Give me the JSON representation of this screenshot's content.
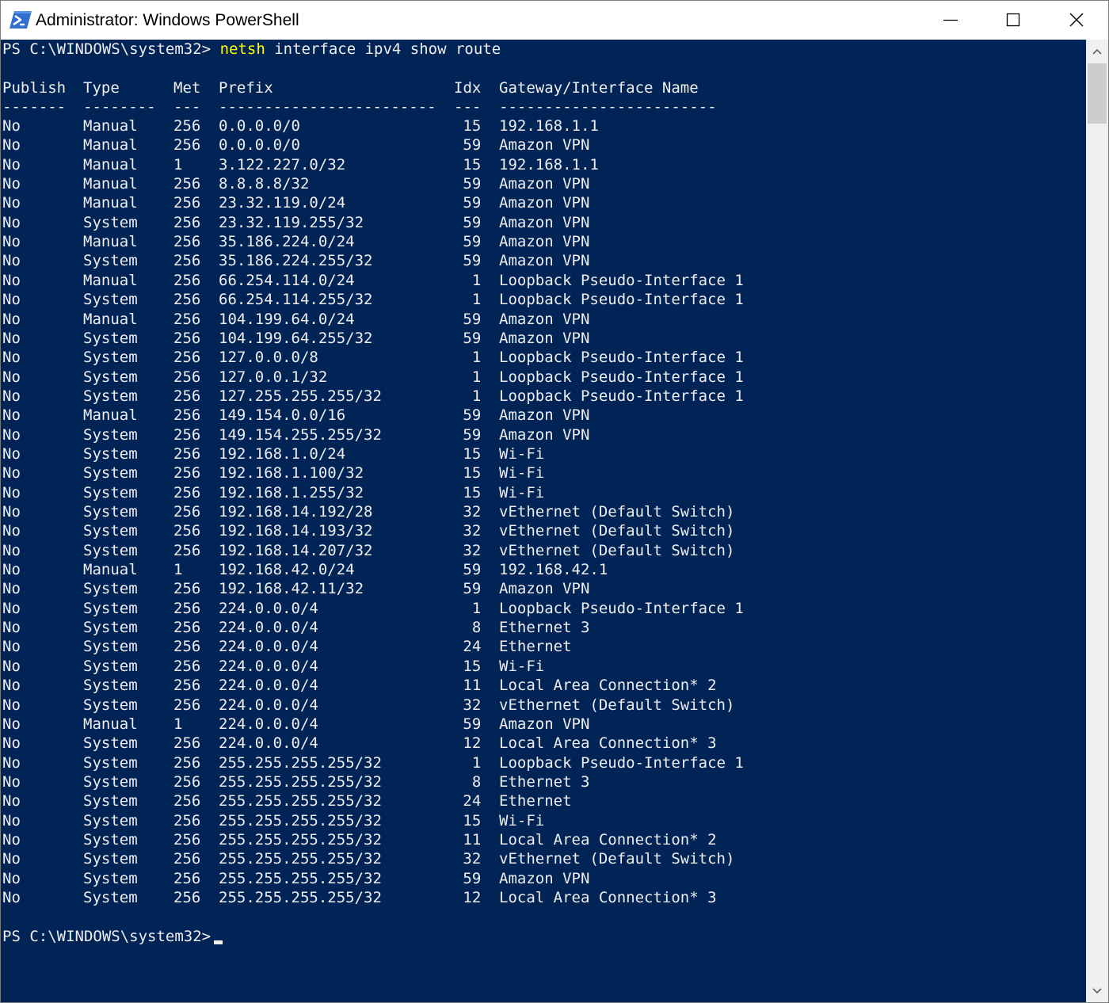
{
  "window": {
    "title": "Administrator: Windows PowerShell",
    "icon": "powershell-icon",
    "controls": {
      "minimize": "minimize-icon",
      "maximize": "maximize-icon",
      "close": "close-icon"
    }
  },
  "colors": {
    "console_bg": "#012456",
    "text": "#eeedf0",
    "command_highlight": "#ffff00"
  },
  "console": {
    "prompt": "PS C:\\WINDOWS\\system32>",
    "command": {
      "program": "netsh",
      "args": "interface ipv4 show route"
    },
    "headers": [
      "Publish",
      "Type",
      "Met",
      "Prefix",
      "Idx",
      "Gateway/Interface Name"
    ],
    "separators": [
      "-------",
      "--------",
      "---",
      "------------------------",
      "---",
      "------------------------"
    ],
    "rows": [
      [
        "No",
        "Manual",
        "256",
        "0.0.0.0/0",
        "15",
        "192.168.1.1"
      ],
      [
        "No",
        "Manual",
        "256",
        "0.0.0.0/0",
        "59",
        "Amazon VPN"
      ],
      [
        "No",
        "Manual",
        "1",
        "3.122.227.0/32",
        "15",
        "192.168.1.1"
      ],
      [
        "No",
        "Manual",
        "256",
        "8.8.8.8/32",
        "59",
        "Amazon VPN"
      ],
      [
        "No",
        "Manual",
        "256",
        "23.32.119.0/24",
        "59",
        "Amazon VPN"
      ],
      [
        "No",
        "System",
        "256",
        "23.32.119.255/32",
        "59",
        "Amazon VPN"
      ],
      [
        "No",
        "Manual",
        "256",
        "35.186.224.0/24",
        "59",
        "Amazon VPN"
      ],
      [
        "No",
        "System",
        "256",
        "35.186.224.255/32",
        "59",
        "Amazon VPN"
      ],
      [
        "No",
        "Manual",
        "256",
        "66.254.114.0/24",
        "1",
        "Loopback Pseudo-Interface 1"
      ],
      [
        "No",
        "System",
        "256",
        "66.254.114.255/32",
        "1",
        "Loopback Pseudo-Interface 1"
      ],
      [
        "No",
        "Manual",
        "256",
        "104.199.64.0/24",
        "59",
        "Amazon VPN"
      ],
      [
        "No",
        "System",
        "256",
        "104.199.64.255/32",
        "59",
        "Amazon VPN"
      ],
      [
        "No",
        "System",
        "256",
        "127.0.0.0/8",
        "1",
        "Loopback Pseudo-Interface 1"
      ],
      [
        "No",
        "System",
        "256",
        "127.0.0.1/32",
        "1",
        "Loopback Pseudo-Interface 1"
      ],
      [
        "No",
        "System",
        "256",
        "127.255.255.255/32",
        "1",
        "Loopback Pseudo-Interface 1"
      ],
      [
        "No",
        "Manual",
        "256",
        "149.154.0.0/16",
        "59",
        "Amazon VPN"
      ],
      [
        "No",
        "System",
        "256",
        "149.154.255.255/32",
        "59",
        "Amazon VPN"
      ],
      [
        "No",
        "System",
        "256",
        "192.168.1.0/24",
        "15",
        "Wi-Fi"
      ],
      [
        "No",
        "System",
        "256",
        "192.168.1.100/32",
        "15",
        "Wi-Fi"
      ],
      [
        "No",
        "System",
        "256",
        "192.168.1.255/32",
        "15",
        "Wi-Fi"
      ],
      [
        "No",
        "System",
        "256",
        "192.168.14.192/28",
        "32",
        "vEthernet (Default Switch)"
      ],
      [
        "No",
        "System",
        "256",
        "192.168.14.193/32",
        "32",
        "vEthernet (Default Switch)"
      ],
      [
        "No",
        "System",
        "256",
        "192.168.14.207/32",
        "32",
        "vEthernet (Default Switch)"
      ],
      [
        "No",
        "Manual",
        "1",
        "192.168.42.0/24",
        "59",
        "192.168.42.1"
      ],
      [
        "No",
        "System",
        "256",
        "192.168.42.11/32",
        "59",
        "Amazon VPN"
      ],
      [
        "No",
        "System",
        "256",
        "224.0.0.0/4",
        "1",
        "Loopback Pseudo-Interface 1"
      ],
      [
        "No",
        "System",
        "256",
        "224.0.0.0/4",
        "8",
        "Ethernet 3"
      ],
      [
        "No",
        "System",
        "256",
        "224.0.0.0/4",
        "24",
        "Ethernet"
      ],
      [
        "No",
        "System",
        "256",
        "224.0.0.0/4",
        "15",
        "Wi-Fi"
      ],
      [
        "No",
        "System",
        "256",
        "224.0.0.0/4",
        "11",
        "Local Area Connection* 2"
      ],
      [
        "No",
        "System",
        "256",
        "224.0.0.0/4",
        "32",
        "vEthernet (Default Switch)"
      ],
      [
        "No",
        "Manual",
        "1",
        "224.0.0.0/4",
        "59",
        "Amazon VPN"
      ],
      [
        "No",
        "System",
        "256",
        "224.0.0.0/4",
        "12",
        "Local Area Connection* 3"
      ],
      [
        "No",
        "System",
        "256",
        "255.255.255.255/32",
        "1",
        "Loopback Pseudo-Interface 1"
      ],
      [
        "No",
        "System",
        "256",
        "255.255.255.255/32",
        "8",
        "Ethernet 3"
      ],
      [
        "No",
        "System",
        "256",
        "255.255.255.255/32",
        "24",
        "Ethernet"
      ],
      [
        "No",
        "System",
        "256",
        "255.255.255.255/32",
        "15",
        "Wi-Fi"
      ],
      [
        "No",
        "System",
        "256",
        "255.255.255.255/32",
        "11",
        "Local Area Connection* 2"
      ],
      [
        "No",
        "System",
        "256",
        "255.255.255.255/32",
        "32",
        "vEthernet (Default Switch)"
      ],
      [
        "No",
        "System",
        "256",
        "255.255.255.255/32",
        "59",
        "Amazon VPN"
      ],
      [
        "No",
        "System",
        "256",
        "255.255.255.255/32",
        "12",
        "Local Area Connection* 3"
      ]
    ]
  }
}
